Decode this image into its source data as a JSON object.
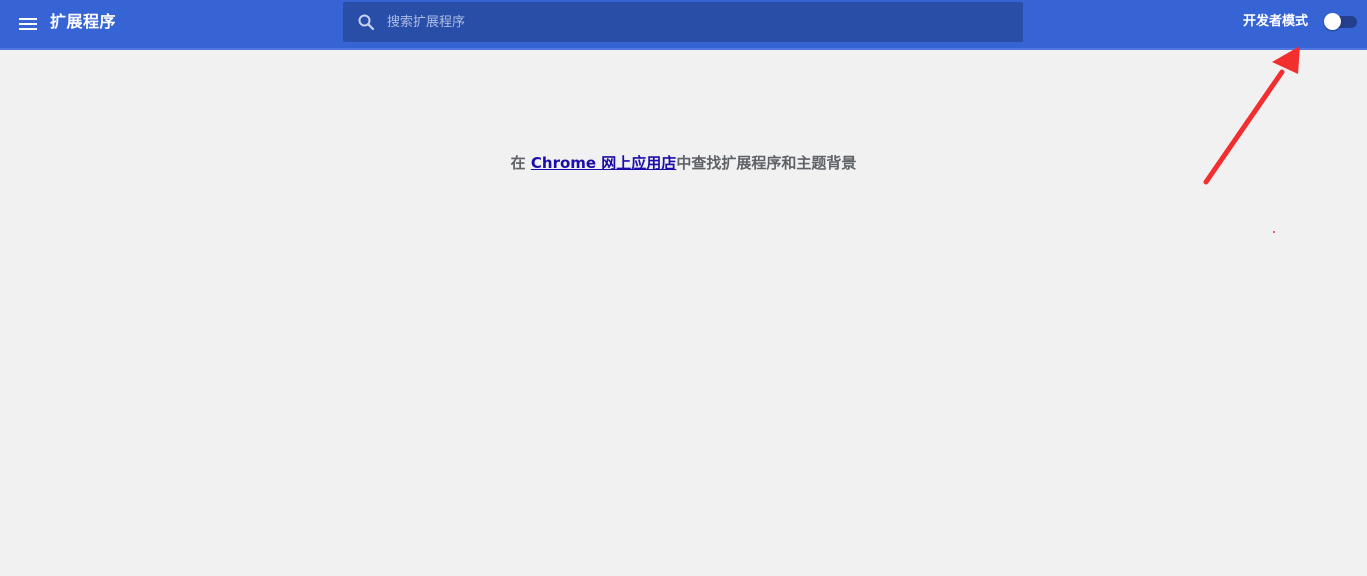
{
  "toolbar": {
    "title": "扩展程序",
    "menu_icon": "hamburger-menu-icon",
    "search": {
      "icon": "search-icon",
      "placeholder": "搜索扩展程序",
      "value": ""
    },
    "developer_mode": {
      "label": "开发者模式",
      "enabled": false
    }
  },
  "main": {
    "empty_message": {
      "prefix": "在 ",
      "link_text": "Chrome 网上应用店",
      "suffix": "中查找扩展程序和主题背景"
    }
  },
  "annotation": {
    "icon": "red-arrow-icon"
  },
  "colors": {
    "toolbar_bg": "#3764d5",
    "search_bg": "#294ea8",
    "page_bg": "#f1f1f1",
    "link": "#1a0dab",
    "annotation_arrow": "#f22e2e"
  }
}
